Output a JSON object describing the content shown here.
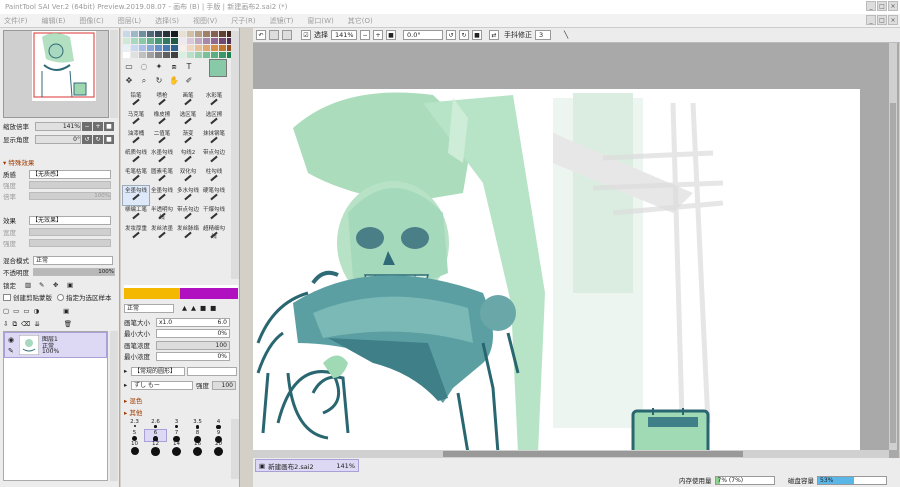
{
  "title": "PaintTool SAI Ver.2 (64bit) Preview.2019.08.07 - 画布 (B) | 手版 | 新建画布2.sai2 (*)",
  "window_buttons": [
    "_",
    "□",
    "×"
  ],
  "menu": [
    "文件(F)",
    "编辑(E)",
    "图像(C)",
    "图层(L)",
    "选择(S)",
    "视图(V)",
    "尺子(R)",
    "滤镜(T)",
    "窗口(W)",
    "其它(O)"
  ],
  "navigator": {
    "zoom_label": "缩放倍率",
    "zoom_value": "141%",
    "angle_label": "显示角度",
    "angle_value": "0°"
  },
  "effects": {
    "section": "特殊效果",
    "texture_label": "质感",
    "texture_value": "【无质感】",
    "strength_label": "强度",
    "scale_label": "倍率",
    "scale_value": "100%",
    "effect_label": "效果",
    "effect_value": "【无效果】",
    "width_label": "宽度",
    "effect_strength_label": "强度",
    "blend_label": "混合模式",
    "blend_value": "正常",
    "opacity_label": "不透明度",
    "opacity_value": "100%",
    "lock_label": "锁定",
    "clip_label": "创建剪贴蒙版",
    "sample_label": "指定为选区样本"
  },
  "layer": {
    "name": "图层1",
    "mode": "正常",
    "opacity": "100%"
  },
  "tools": {
    "labels": [
      "铅笔",
      "喷枪",
      "画笔",
      "水彩笔",
      "马克笔",
      "橡皮擦",
      "选区笔",
      "选区擦",
      "油漆桶",
      "二值笔",
      "渐变",
      "抹抹钢笔",
      "纸质勾线",
      "水墨勾线",
      "勾线2",
      "带点勾边",
      "毛笔枯笔",
      "圆素毛笔",
      "双化勾",
      "柱勾线",
      "全墨勾线",
      "全墨勾线",
      "多水勾线",
      "硬笔勾线",
      "柳编工笔",
      "半透明勾线",
      "带点勾边",
      "干爆勾线",
      "发妆厚重",
      "发丝浓墨",
      "发丝脉络",
      "超精细勾线"
    ],
    "selected_index": 20
  },
  "brush": {
    "mode": "正常",
    "size_label": "画笔大小",
    "size_mult": "x1.0",
    "size_value": "6.0",
    "min_size_label": "最小大小",
    "min_size_value": "0%",
    "density_label": "画笔浓度",
    "density_value": "100",
    "min_density_label": "最小浓度",
    "min_density_value": "0%",
    "shape_value": "【常规的圆形】",
    "texture_value": "ずし もー",
    "strength_label": "强度",
    "strength_value": "100",
    "mix_label": "混色",
    "other_label": "其他",
    "sizes": [
      "2.3",
      "2.6",
      "3",
      "3.5",
      "4",
      "5",
      "6",
      "7",
      "8",
      "9",
      "10",
      "12",
      "14",
      "16",
      "20"
    ],
    "selected_size": "6"
  },
  "canvas_toolbar": {
    "selection_label": "选择",
    "zoom": "141%",
    "angle": "0.0°",
    "stabilizer_label": "手抖修正",
    "stabilizer_value": "3"
  },
  "status": {
    "doc_name": "新建画布2.sai2",
    "doc_zoom": "141%",
    "memory_label": "内存使用量",
    "memory_value": "7% (7%)",
    "memory_fraction": 0.07,
    "disk_label": "磁盘容量",
    "disk_value": "53%",
    "disk_fraction": 0.53
  },
  "colors": {
    "current": "#88c9a8",
    "ui_panel": "#ececec",
    "canvas_bg": "#ffffff",
    "sketch_green": "#8fd1a6",
    "line_teal": "#2f6b77",
    "accent_yellow": "#f5b800",
    "accent_purple": "#b010c0"
  }
}
